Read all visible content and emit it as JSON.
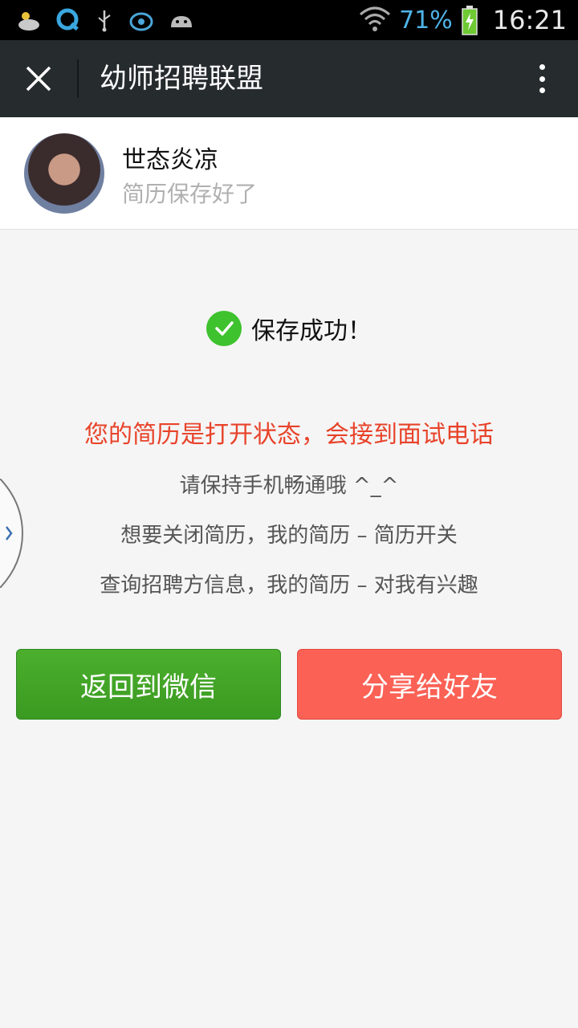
{
  "status_bar": {
    "icons_left": [
      "weather-icon",
      "q-app-icon",
      "usb-icon",
      "bird-app-icon",
      "android-icon"
    ],
    "battery_percent": "71%",
    "time": "16:21"
  },
  "title_bar": {
    "title": "幼师招聘联盟"
  },
  "profile": {
    "name": "世态炎凉",
    "subtitle": "简历保存好了"
  },
  "main": {
    "success_text": "保存成功！",
    "notice": "您的简历是打开状态，会接到面试电话",
    "line1": "请保持手机畅通哦 ^_^",
    "line2": "想要关闭简历，我的简历 – 简历开关",
    "line3": "查询招聘方信息，我的简历 – 对我有兴趣"
  },
  "buttons": {
    "back": "返回到微信",
    "share": "分享给好友"
  },
  "colors": {
    "notice": "#e8432a",
    "back_button": "#3fa426",
    "share_button": "#fb6155",
    "check": "#3ec22e"
  }
}
